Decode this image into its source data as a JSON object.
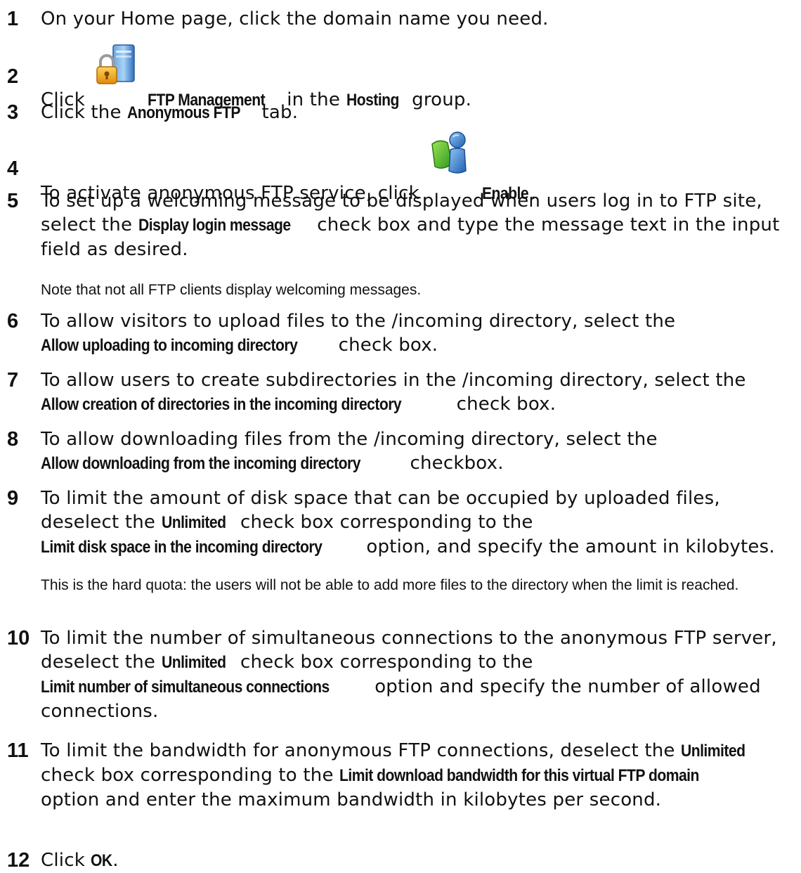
{
  "steps": [
    {
      "number": "1",
      "text": "On your Home page, click the domain name you need."
    },
    {
      "number": "2",
      "pre": "Click",
      "icon": "ftp-management-icon",
      "ui1": "FTP Management",
      "mid": "in the",
      "ui2": "Hosting",
      "post": "group."
    },
    {
      "number": "3",
      "pre": "Click the",
      "ui1": "Anonymous FTP",
      "post": "tab."
    },
    {
      "number": "4",
      "pre": "To activate anonymous FTP service, click",
      "icon": "enable-icon",
      "ui1": "Enable",
      "post": "."
    },
    {
      "number": "5",
      "pre": "To set up a welcoming message to be displayed when users log in to FTP site, select the",
      "ui1": "Display login message",
      "post": "check box and type the message text in the input field as desired.",
      "note": "Note that not all FTP clients display welcoming messages."
    },
    {
      "number": "6",
      "pre": "To allow visitors to upload files to the /incoming directory, select the",
      "ui1": "Allow uploading to incoming directory",
      "post": "check box."
    },
    {
      "number": "7",
      "pre": "To allow users to create subdirectories in the /incoming directory, select the",
      "ui1": "Allow creation of directories in the incoming directory",
      "post": "check box."
    },
    {
      "number": "8",
      "pre": "To allow downloading files from the /incoming directory, select the",
      "ui1": "Allow downloading from the incoming directory",
      "post": "checkbox."
    },
    {
      "number": "9",
      "pre": "To limit the amount of disk space that can be occupied by uploaded files, deselect the",
      "ui1": "Unlimited",
      "mid": "check box corresponding to the",
      "ui2": "Limit disk space in the incoming directory",
      "post": "option, and specify the amount in kilobytes.",
      "note": "This is the hard quota: the users will not be able to add more files to the directory when the limit is reached."
    },
    {
      "number": "10",
      "pre": "To limit the number of simultaneous connections to the anonymous FTP server, deselect the",
      "ui1": "Unlimited",
      "mid": "check box corresponding to the",
      "ui2": "Limit number of simultaneous connections",
      "post": "option and specify the number of allowed connections."
    },
    {
      "number": "11",
      "pre": "To limit the bandwidth for anonymous FTP connections, deselect the",
      "ui1": "Unlimited",
      "mid": "check box corresponding to the",
      "ui2": "Limit download bandwidth for this virtual FTP domain",
      "post": "option and enter the maximum bandwidth in kilobytes per second."
    },
    {
      "number": "12",
      "pre": "Click",
      "ui1": "OK",
      "post": "."
    }
  ]
}
